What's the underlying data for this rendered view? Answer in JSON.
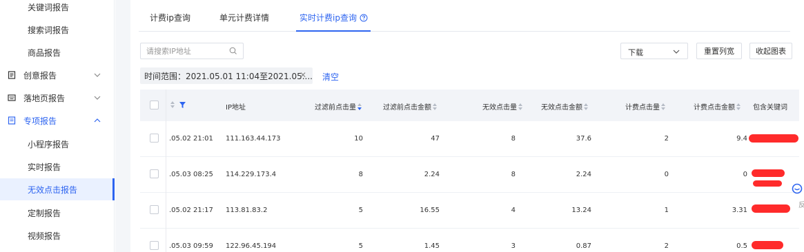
{
  "sidebar": {
    "items": [
      {
        "label": "关键词报告",
        "kind": "sub"
      },
      {
        "label": "搜索词报告",
        "kind": "sub"
      },
      {
        "label": "商品报告",
        "kind": "sub"
      },
      {
        "label": "创意报告",
        "kind": "group",
        "icon": "document-icon",
        "expanded": false
      },
      {
        "label": "落地页报告",
        "kind": "group",
        "icon": "keyboard-icon",
        "expanded": false
      },
      {
        "label": "专项报告",
        "kind": "group",
        "icon": "list-icon",
        "expanded": true
      },
      {
        "label": "小程序报告",
        "kind": "sub"
      },
      {
        "label": "实时报告",
        "kind": "sub"
      },
      {
        "label": "无效点击报告",
        "kind": "sub",
        "active": true
      },
      {
        "label": "定制报告",
        "kind": "sub"
      },
      {
        "label": "视频报告",
        "kind": "sub"
      }
    ]
  },
  "tabs": [
    {
      "label": "计费ip查询"
    },
    {
      "label": "单元计费详情"
    },
    {
      "label": "实时计费ip查询",
      "active": true,
      "icon": "help-circle-icon"
    }
  ],
  "toolbar": {
    "search_placeholder": "请搜索IP地址",
    "download_label": "下载",
    "reset_width_label": "重置列宽",
    "collapse_chart_label": "收起图表"
  },
  "filter": {
    "tag_text": "时间范围：2021.05.01 11:04至2021.05....",
    "clear_label": "清空"
  },
  "table": {
    "columns": [
      "",
      "IP地址",
      "过滤前点击量",
      "过滤前点击金额",
      "无效点击量",
      "无效点击金额",
      "计费点击量",
      "计费点击金额",
      "包含关键词"
    ],
    "rows": [
      {
        "time": ".05.02 21:01",
        "ip": "111.163.44.173",
        "pre_clicks": "10",
        "pre_amount": "47",
        "invalid_clicks": "8",
        "invalid_amount": "37.6",
        "billed_clicks": "2",
        "billed_amount": "9.4"
      },
      {
        "time": ".05.03 08:25",
        "ip": "114.229.173.4",
        "pre_clicks": "8",
        "pre_amount": "2.24",
        "invalid_clicks": "8",
        "invalid_amount": "2.24",
        "billed_clicks": "0",
        "billed_amount": "0"
      },
      {
        "time": ".05.02 21:17",
        "ip": "113.81.83.2",
        "pre_clicks": "5",
        "pre_amount": "16.55",
        "invalid_clicks": "4",
        "invalid_amount": "13.24",
        "billed_clicks": "1",
        "billed_amount": "3.31"
      },
      {
        "time": ".05.03 09:59",
        "ip": "122.96.45.194",
        "pre_clicks": "5",
        "pre_amount": "1.45",
        "invalid_clicks": "3",
        "invalid_amount": "0.87",
        "billed_clicks": "2",
        "billed_amount": "0.5"
      }
    ]
  },
  "float_help": {
    "label": "反"
  },
  "colors": {
    "accent": "#2d64f0",
    "redaction": "#ff2b2b"
  }
}
